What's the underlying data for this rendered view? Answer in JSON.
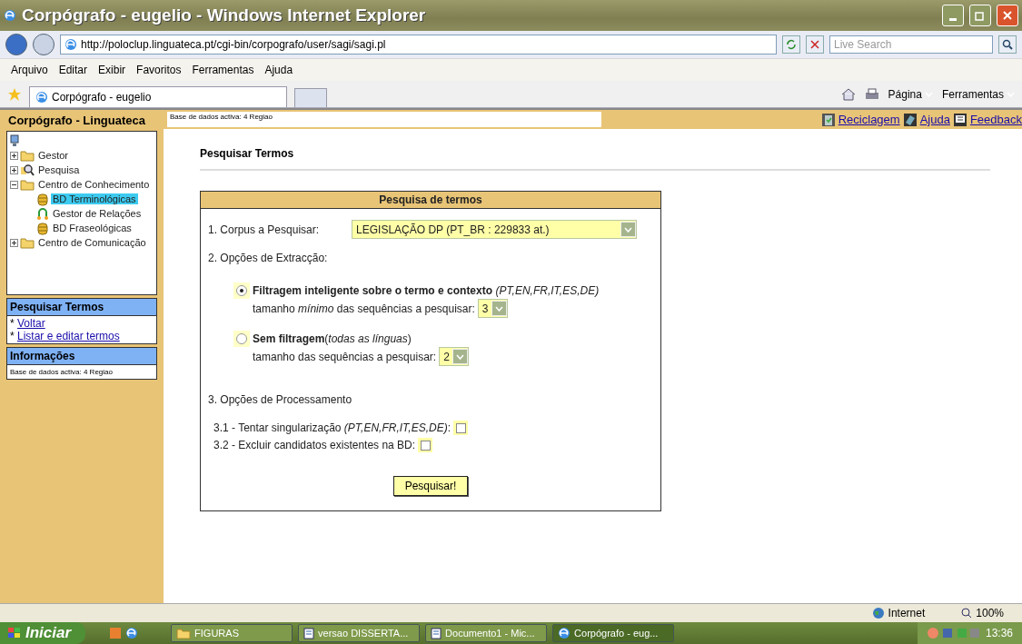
{
  "window": {
    "title": "Corpógrafo - eugelio - Windows Internet Explorer"
  },
  "address": {
    "url": "http://poloclup.linguateca.pt/cgi-bin/corpografo/user/sagi/sagi.pl"
  },
  "search": {
    "placeholder": "Live Search"
  },
  "menu": [
    "Arquivo",
    "Editar",
    "Exibir",
    "Favoritos",
    "Ferramentas",
    "Ajuda"
  ],
  "tabs": [
    {
      "label": "Corpógrafo - eugelio",
      "selected": true
    }
  ],
  "toolbar": [
    "Página",
    "Ferramentas"
  ],
  "page": {
    "sidebar_title": "Corpógrafo - Linguateca",
    "active_db": "Base de dados activa: 4 Regiao",
    "links": [
      {
        "kind": "recycle",
        "label": "Reciclagem"
      },
      {
        "kind": "help",
        "label": "Ajuda"
      },
      {
        "kind": "feedback",
        "label": "Feedback"
      }
    ],
    "tree": [
      {
        "kind": "computer",
        "children": [
          {
            "kind": "folder",
            "label": "Gestor",
            "expanded": false,
            "selected": false
          },
          {
            "kind": "search",
            "label": "Pesquisa",
            "expanded": false,
            "selected": false
          },
          {
            "kind": "folder",
            "label": "Centro de Conhecimento",
            "expanded": true,
            "selected": false,
            "children": [
              {
                "kind": "db",
                "label": "BD Terminológicas",
                "selected": true
              },
              {
                "kind": "relation",
                "label": "Gestor de Relações",
                "selected": false
              },
              {
                "kind": "db",
                "label": "BD Fraseológicas",
                "selected": false
              }
            ]
          },
          {
            "kind": "folder",
            "label": "Centro de Comunicação",
            "expanded": false,
            "selected": false
          }
        ]
      }
    ],
    "panels": [
      {
        "title": "Pesquisar Termos",
        "links": [
          {
            "marker": "*",
            "label": "Voltar"
          },
          {
            "marker": "*",
            "label": "Listar e editar termos"
          }
        ]
      },
      {
        "title": "Informações",
        "text": "Base de dados activa: 4 Regiao"
      }
    ],
    "heading": "Pesquisar Termos",
    "form": {
      "title": "Pesquisa de termos",
      "corpus": {
        "label": "1. Corpus a Pesquisar:",
        "value": "LEGISLAÇÃO DP (PT_BR : 229833 at.)"
      },
      "extraction_label": "2. Opções de Extracção:",
      "options": [
        {
          "selected": true,
          "title": "**Filtragem inteligente sobre o termo e contexto** *(PT,EN,FR,IT,ES,DE)*",
          "size_label": "tamanho *mínimo* das sequências a pesquisar:",
          "size_value": "3"
        },
        {
          "selected": false,
          "title": "**Sem filtragem**(*todas as línguas*)",
          "size_label": "tamanho das sequências a pesquisar:",
          "size_value": "2"
        }
      ],
      "processing_label": "3. Opções de Processamento",
      "checks": [
        {
          "label": "3.1 - Tentar singularização *(PT,EN,FR,IT,ES,DE)*:",
          "checked": false
        },
        {
          "label": "3.2 - Excluir candidatos existentes na BD:",
          "checked": false
        }
      ],
      "submit": "Pesquisar!"
    }
  },
  "status_bar": {
    "zone": "Internet",
    "zoom": "100%"
  },
  "taskbar": {
    "start": "Iniciar",
    "items": [
      {
        "label": "FIGURAS",
        "kind": "folder",
        "selected": false
      },
      {
        "label": "versao DISSERTA...",
        "kind": "doc",
        "selected": false
      },
      {
        "label": "Documento1 - Mic...",
        "kind": "doc",
        "selected": false
      },
      {
        "label": "Corpógrafo - eug...",
        "kind": "ie",
        "selected": true
      }
    ],
    "clock": "13:36"
  }
}
